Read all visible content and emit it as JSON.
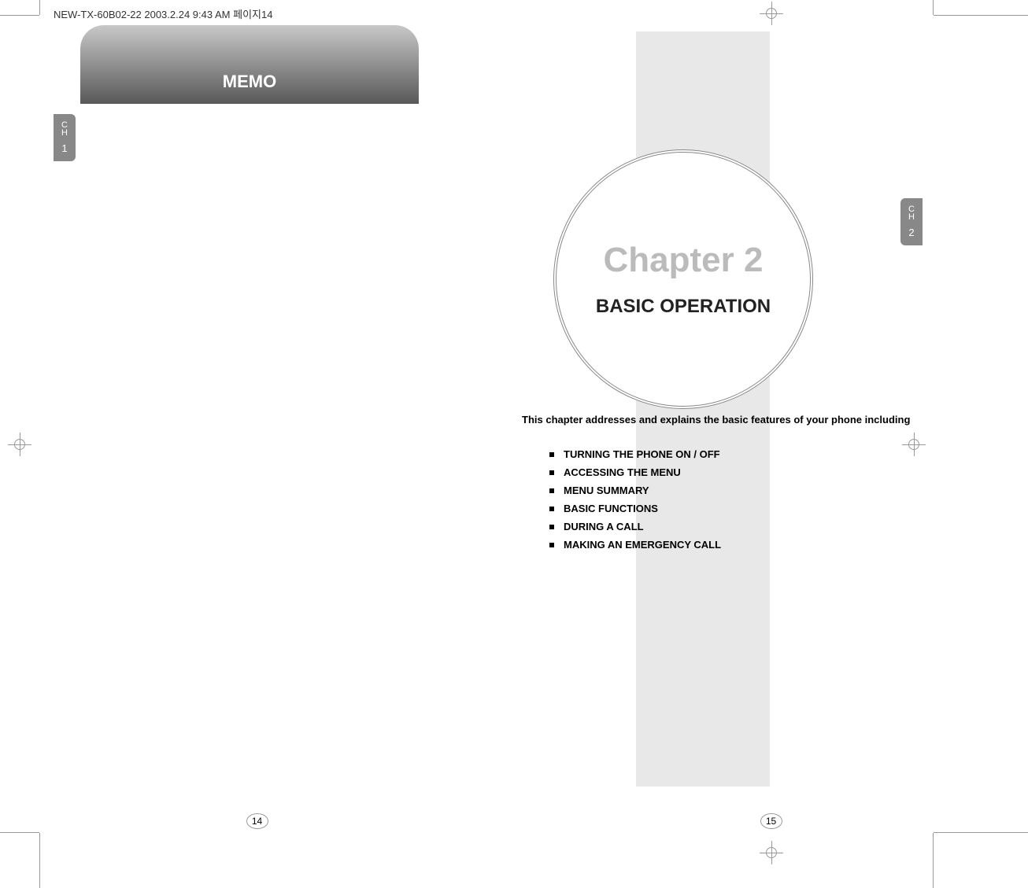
{
  "header": {
    "meta": "NEW-TX-60B02-22  2003.2.24 9:43 AM  페이지14"
  },
  "leftPage": {
    "memoTitle": "MEMO",
    "chTab": {
      "letter1": "C",
      "letter2": "H",
      "num": "1"
    },
    "pageNum": "14"
  },
  "rightPage": {
    "chTab": {
      "letter1": "C",
      "letter2": "H",
      "num": "2"
    },
    "chapterTitle": "Chapter 2",
    "chapterSubtitle": "BASIC OPERATION",
    "introText": "This chapter addresses and explains the basic features of your phone including",
    "bullets": [
      "TURNING THE PHONE ON / OFF",
      "ACCESSING THE MENU",
      "MENU SUMMARY",
      "BASIC FUNCTIONS",
      "DURING A CALL",
      "MAKING AN EMERGENCY CALL"
    ],
    "pageNum": "15"
  }
}
